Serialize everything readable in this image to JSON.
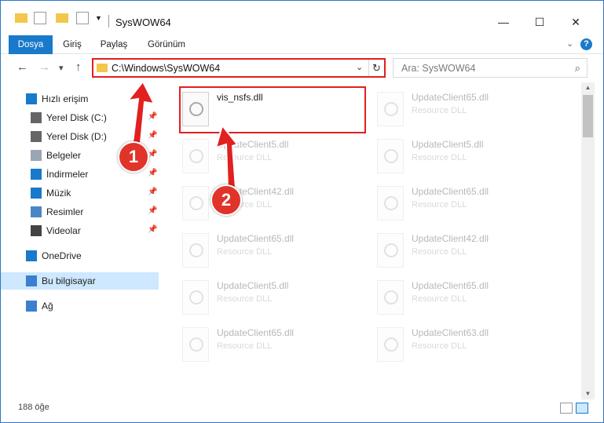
{
  "window": {
    "title": "SysWOW64",
    "controls": {
      "minimize": "—",
      "maximize": "☐",
      "close": "✕"
    }
  },
  "ribbon": {
    "tabs": [
      "Dosya",
      "Giriş",
      "Paylaş",
      "Görünüm"
    ],
    "help": "?"
  },
  "nav": {
    "back": "←",
    "forward": "→",
    "recent": "▾",
    "up": "↑",
    "address": "C:\\Windows\\SysWOW64",
    "refresh": "↻",
    "search_placeholder": "Ara: SysWOW64"
  },
  "sidebar": {
    "items": [
      {
        "label": "Hızlı erişim",
        "icon": "star-icon",
        "pinned": false
      },
      {
        "label": "Yerel Disk (C:)",
        "icon": "disk-icon",
        "pinned": true
      },
      {
        "label": "Yerel Disk (D:)",
        "icon": "disk-icon",
        "pinned": true
      },
      {
        "label": "Belgeler",
        "icon": "documents-icon",
        "pinned": true
      },
      {
        "label": "İndirmeler",
        "icon": "downloads-icon",
        "pinned": true
      },
      {
        "label": "Müzik",
        "icon": "music-icon",
        "pinned": true
      },
      {
        "label": "Resimler",
        "icon": "pictures-icon",
        "pinned": true
      },
      {
        "label": "Videolar",
        "icon": "videos-icon",
        "pinned": true
      },
      {
        "label": "OneDrive",
        "icon": "onedrive-icon",
        "pinned": false
      },
      {
        "label": "Bu bilgisayar",
        "icon": "computer-icon",
        "pinned": false
      },
      {
        "label": "Ağ",
        "icon": "network-icon",
        "pinned": false
      }
    ]
  },
  "files": [
    {
      "name": "vis_nsfs.dll",
      "type": "",
      "highlighted": true
    },
    {
      "name": "UpdateClient65.dll",
      "type": "Resource DLL"
    },
    {
      "name": "UpdateClient5.dll",
      "type": "Resource DLL"
    },
    {
      "name": "UpdateClient5.dll",
      "type": "Resource DLL"
    },
    {
      "name": "UpdateClient42.dll",
      "type": "Resource DLL"
    },
    {
      "name": "UpdateClient65.dll",
      "type": "Resource DLL"
    },
    {
      "name": "UpdateClient65.dll",
      "type": "Resource DLL"
    },
    {
      "name": "UpdateClient42.dll",
      "type": "Resource DLL"
    },
    {
      "name": "UpdateClient5.dll",
      "type": "Resource DLL"
    },
    {
      "name": "UpdateClient65.dll",
      "type": "Resource DLL"
    },
    {
      "name": "UpdateClient65.dll",
      "type": "Resource DLL"
    },
    {
      "name": "UpdateClient63.dll",
      "type": "Resource DLL"
    }
  ],
  "status": {
    "count": "188 öğe"
  },
  "annotations": {
    "step1": "1",
    "step2": "2",
    "color": "#e1201f"
  }
}
